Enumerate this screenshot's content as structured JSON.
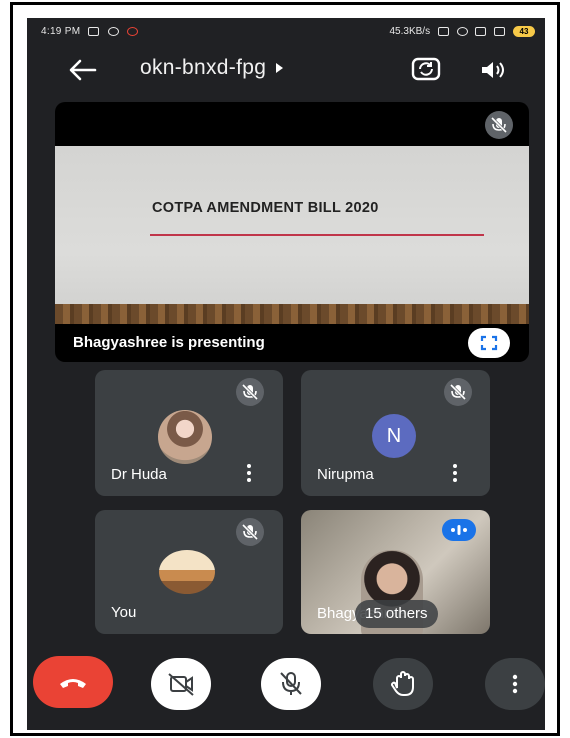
{
  "status_bar": {
    "time": "4:19 PM",
    "network_speed": "45.3KB/s",
    "battery": "43"
  },
  "header": {
    "meeting_code": "okn-bnxd-fpg"
  },
  "presentation": {
    "slide_title": "COTPA AMENDMENT BILL 2020",
    "presenting_label": "Bhagyashree is presenting"
  },
  "participants": [
    {
      "name": "Dr Huda",
      "avatar": "photo",
      "muted": true
    },
    {
      "name": "Nirupma",
      "avatar_initial": "N",
      "muted": true
    },
    {
      "name": "You",
      "avatar": "photo",
      "muted": true
    },
    {
      "name": "Bhagyashree",
      "others_label": "15 others",
      "speaking": true
    }
  ],
  "controls": [
    "end-call",
    "camera-off",
    "mic-off",
    "raise-hand",
    "more-options"
  ],
  "colors": {
    "background": "#202124",
    "tile": "#3c4043",
    "end_call": "#ea4335",
    "accent_blue": "#1a73e8",
    "avatar_n": "#5c6bc0"
  }
}
